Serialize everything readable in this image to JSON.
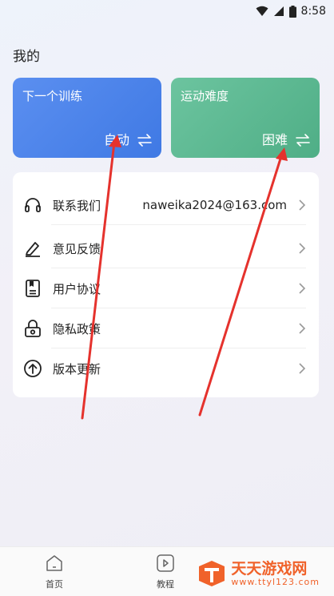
{
  "status_bar": {
    "time": "8:58",
    "icons": [
      "wifi-icon",
      "signal-icon",
      "battery-icon"
    ]
  },
  "page": {
    "title": "我的"
  },
  "cards": [
    {
      "title": "下一个训练",
      "value": "自动",
      "icon": "swap-icon",
      "color": "#4a84ea"
    },
    {
      "title": "运动难度",
      "value": "困难",
      "icon": "swap-icon",
      "color": "#5cb891"
    }
  ],
  "menu": {
    "items": [
      {
        "label": "联系我们",
        "value": "naweika2024@163.com",
        "icon": "headset-icon"
      },
      {
        "label": "意见反馈",
        "value": "",
        "icon": "pen-icon"
      },
      {
        "label": "用户协议",
        "value": "",
        "icon": "document-icon"
      },
      {
        "label": "隐私政策",
        "value": "",
        "icon": "lock-icon"
      },
      {
        "label": "版本更新",
        "value": "",
        "icon": "arrow-up-circle-icon"
      }
    ]
  },
  "bottom_nav": {
    "items": [
      {
        "label": "首页",
        "icon": "home-icon"
      },
      {
        "label": "教程",
        "icon": "play-icon"
      }
    ]
  },
  "watermark": {
    "main": "天天游戏网",
    "sub": "www.ttyl123.com",
    "accent": "#f0622a"
  },
  "annotation_color": "#e5322d"
}
